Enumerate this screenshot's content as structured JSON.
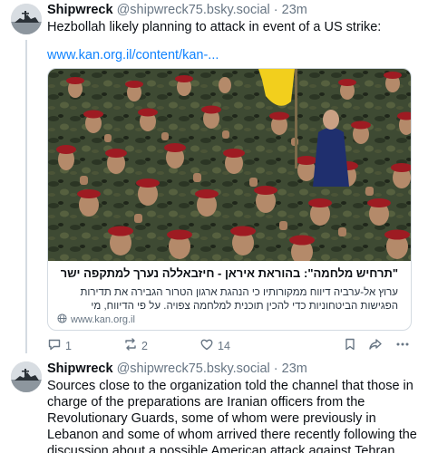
{
  "post1": {
    "author": "Shipwreck",
    "handle": "@shipwreck75.bsky.social",
    "dot": "·",
    "time": "23m",
    "text": "Hezbollah likely planning to attack in event of a US strike:",
    "link": "www.kan.org.il/content/kan-...",
    "card": {
      "title": "\"תרחיש מלחמה\": בהוראת איראן - חיזבאללה נערך למתקפה ישראלית",
      "description": "ערוץ אל-ערביה דיווח ממקורותיו כי הנהגת ארגון הטרור הגבירה את תדירות הפגישות הביטחוניות כדי להכין תוכנית למלחמה צפויה. על פי הדיווח, מי שמנהל את היערכות ה...",
      "domain": "www.kan.org.il"
    },
    "actions": {
      "reply_count": "1",
      "repost_count": "2",
      "like_count": "14"
    }
  },
  "post2": {
    "author": "Shipwreck",
    "handle": "@shipwreck75.bsky.social",
    "dot": "·",
    "time": "23m",
    "text": "Sources close to the organization told the channel that those in charge of the preparations are Iranian officers from the Revolutionary Guards, some of whom were previously in Lebanon and some of whom arrived there recently following the discussion about a possible American attack against Tehran."
  },
  "icons": {
    "reply": "speech-bubble-icon",
    "repost": "repost-arrows-icon",
    "like": "heart-icon",
    "bookmark": "bookmark-icon",
    "share": "share-arrow-icon",
    "more": "ellipsis-icon",
    "globe": "globe-icon"
  },
  "colors": {
    "link": "#1083fe",
    "muted": "#687684",
    "border": "#d4dbe2",
    "flag_yellow": "#f2cf1d",
    "beret_red": "#9e1b22"
  }
}
